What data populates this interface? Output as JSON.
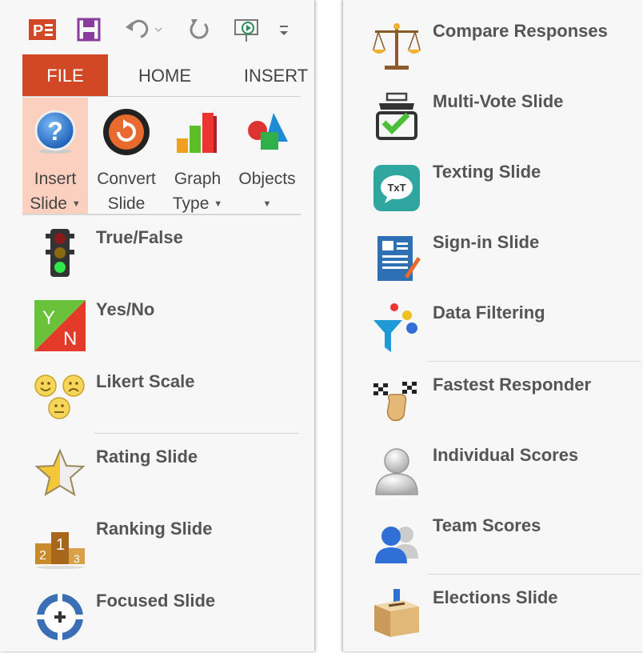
{
  "tabs": {
    "file": "FILE",
    "home": "HOME",
    "insert": "INSERT"
  },
  "ribbon": {
    "insert_slide": {
      "line1": "Insert",
      "line2": "Slide"
    },
    "convert_slide": {
      "line1": "Convert",
      "line2": "Slide"
    },
    "graph_type": {
      "line1": "Graph",
      "line2": "Type"
    },
    "objects": {
      "line1": "Objects",
      "line2": ""
    }
  },
  "left_menu": [
    {
      "label": "True/False",
      "icon": "traffic-light-icon"
    },
    {
      "label": "Yes/No",
      "icon": "yes-no-icon"
    },
    {
      "label": "Likert Scale",
      "icon": "smiley-faces-icon"
    },
    {
      "label": "Rating Slide",
      "icon": "star-icon"
    },
    {
      "label": "Ranking Slide",
      "icon": "podium-icon"
    },
    {
      "label": "Focused Slide",
      "icon": "crosshair-icon"
    }
  ],
  "right_menu": [
    {
      "label": "Compare Responses",
      "icon": "scales-icon"
    },
    {
      "label": "Multi-Vote Slide",
      "icon": "checkbox-tray-icon"
    },
    {
      "label": "Texting Slide",
      "icon": "txt-bubble-icon"
    },
    {
      "label": "Sign-in Slide",
      "icon": "sign-in-form-icon"
    },
    {
      "label": "Data Filtering",
      "icon": "funnel-icon"
    },
    {
      "label": "Fastest Responder",
      "icon": "checkered-flags-icon"
    },
    {
      "label": "Individual Scores",
      "icon": "person-icon"
    },
    {
      "label": "Team Scores",
      "icon": "team-icon"
    },
    {
      "label": "Elections Slide",
      "icon": "ballot-box-icon"
    }
  ],
  "colors": {
    "file_tab": "#d24726",
    "selected": "#fcd0bf",
    "label": "#555555"
  }
}
